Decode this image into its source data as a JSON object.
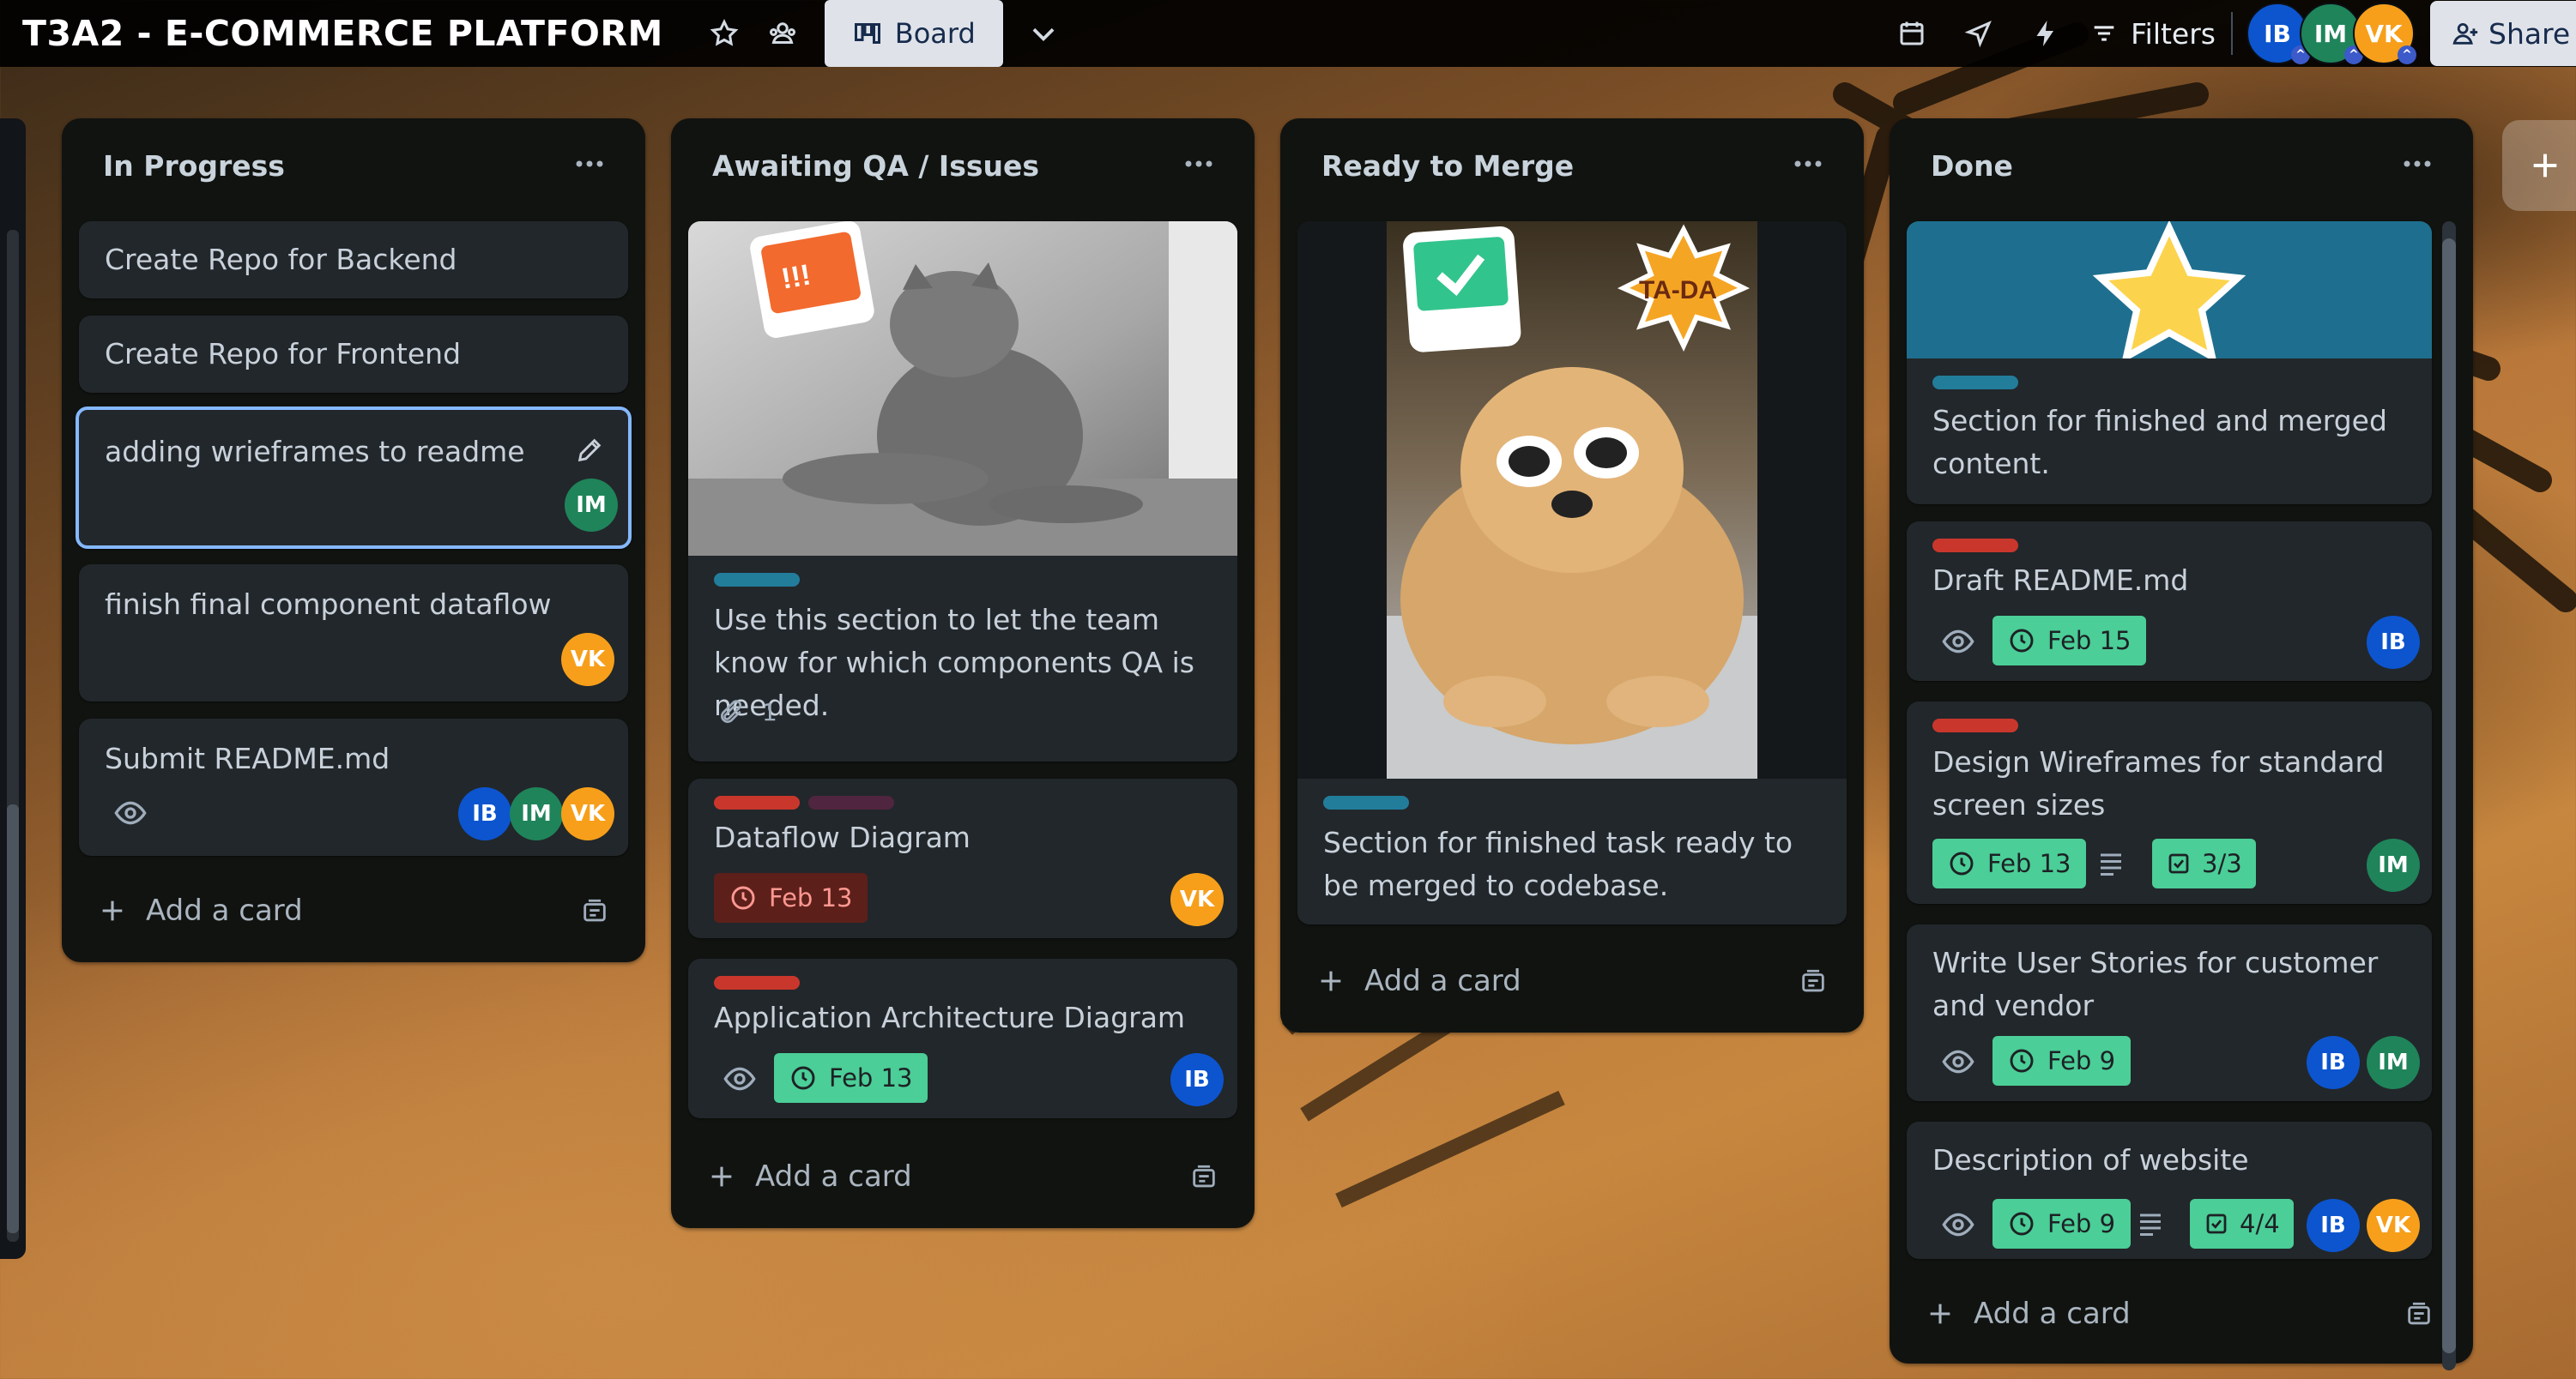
{
  "board": {
    "title": "T3A2 - E-COMMERCE PLATFORM",
    "view_label": "Board"
  },
  "toolbar": {
    "filters_label": "Filters",
    "share_label": "Share"
  },
  "members": [
    "IB",
    "IM",
    "VK"
  ],
  "colors": {
    "IB": "#0c55cf",
    "IM": "#1f845a",
    "VK": "#f79f1a",
    "green_due": "#4bce97",
    "red_label": "#c9372c",
    "teal_label": "#227d9b"
  },
  "lists": {
    "in_progress": {
      "title": "In Progress",
      "cards": [
        {
          "title": "Create Repo for Backend"
        },
        {
          "title": "Create Repo for Frontend"
        },
        {
          "title": "adding wrieframes to readme",
          "members": [
            "IM"
          ]
        },
        {
          "title": "finish final component dataflow",
          "members": [
            "VK"
          ]
        },
        {
          "title": "Submit README.md",
          "members": [
            "IB",
            "IM",
            "VK"
          ]
        }
      ],
      "add_card": "Add a card"
    },
    "awaiting_qa": {
      "title": "Awaiting QA / Issues",
      "cards": [
        {
          "title": "Use this section to let the team know for which components QA is needed.",
          "cover_sticker": "!!!",
          "attachments": "1"
        },
        {
          "title": "Dataflow Diagram",
          "due": "Feb 13",
          "members": [
            "VK"
          ]
        },
        {
          "title": "Application Architecture Diagram",
          "due": "Feb 13",
          "members": [
            "IB"
          ]
        }
      ],
      "add_card": "Add a card"
    },
    "ready_to_merge": {
      "title": "Ready to Merge",
      "cards": [
        {
          "title": "Section for finished task ready to be merged to codebase.",
          "sticker": "TA-DA"
        }
      ],
      "add_card": "Add a card"
    },
    "done": {
      "title": "Done",
      "cards": [
        {
          "title": "Section for finished and merged content."
        },
        {
          "title": "Draft README.md",
          "due": "Feb 15",
          "members": [
            "IB"
          ]
        },
        {
          "title": "Design Wireframes for standard screen sizes",
          "due": "Feb 13",
          "checklist": "3/3",
          "members": [
            "IM"
          ]
        },
        {
          "title": "Write User Stories for customer and vendor",
          "due": "Feb 9",
          "members": [
            "IB",
            "IM"
          ]
        },
        {
          "title": "Description of website",
          "due": "Feb 9",
          "checklist": "4/4",
          "members": [
            "IB",
            "VK"
          ]
        }
      ],
      "add_card": "Add a card"
    }
  },
  "icons": [
    "star-icon",
    "team-visibility-icon",
    "board-icon",
    "chevron-down-icon",
    "calendar-icon",
    "rocket-icon",
    "lightning-icon",
    "filter-icon",
    "add-member-icon",
    "more-icon",
    "edit-icon",
    "eye-icon",
    "clock-icon",
    "description-icon",
    "checklist-icon",
    "attachment-icon",
    "plus-icon",
    "template-icon"
  ]
}
